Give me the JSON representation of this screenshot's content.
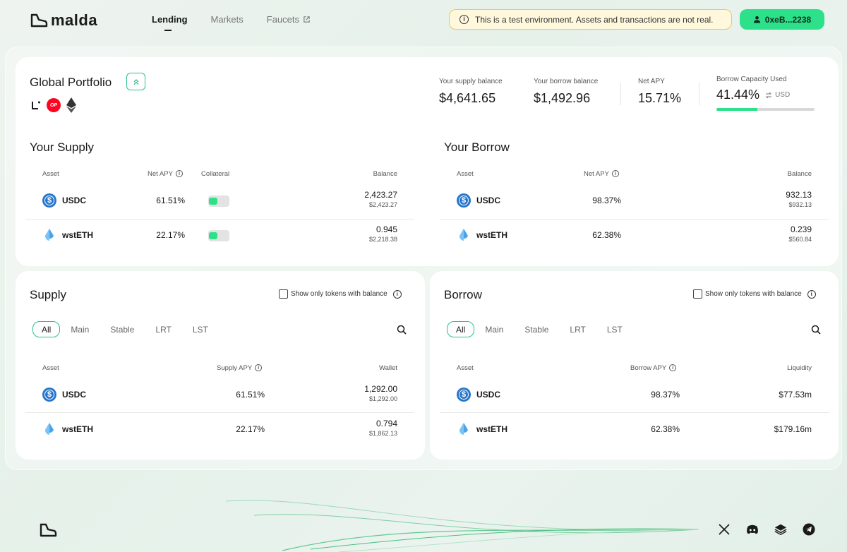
{
  "brand": {
    "name": "malda"
  },
  "nav": [
    {
      "label": "Lending",
      "active": true
    },
    {
      "label": "Markets",
      "active": false
    },
    {
      "label": "Faucets",
      "active": false,
      "external": true
    }
  ],
  "notice": {
    "text": "This is a test environment. Assets and transactions are not real."
  },
  "wallet": {
    "address": "0xeB...2238"
  },
  "portfolio": {
    "title": "Global Portfolio",
    "chains": [
      "linea-icon",
      "optimism-icon",
      "ethereum-icon"
    ],
    "op_label": "OP",
    "stats": {
      "supply_label": "Your supply balance",
      "supply_value": "$4,641.65",
      "borrow_label": "Your borrow balance",
      "borrow_value": "$1,492.96",
      "apy_label": "Net APY",
      "apy_value": "15.71%",
      "capacity_label": "Borrow Capacity Used",
      "capacity_value": "41.44%",
      "capacity_unit": "USD",
      "capacity_fraction": 0.4144
    }
  },
  "your_supply": {
    "title": "Your Supply",
    "headers": {
      "asset": "Asset",
      "apy": "Net APY",
      "collateral": "Collateral",
      "balance": "Balance"
    },
    "rows": [
      {
        "asset": "USDC",
        "apy": "61.51%",
        "collateral": true,
        "balance": "2,423.27",
        "balance_usd": "$2,423.27"
      },
      {
        "asset": "wstETH",
        "apy": "22.17%",
        "collateral": true,
        "balance": "0.945",
        "balance_usd": "$2,218.38"
      }
    ]
  },
  "your_borrow": {
    "title": "Your Borrow",
    "headers": {
      "asset": "Asset",
      "apy": "Net APY",
      "balance": "Balance"
    },
    "rows": [
      {
        "asset": "USDC",
        "apy": "98.37%",
        "balance": "932.13",
        "balance_usd": "$932.13"
      },
      {
        "asset": "wstETH",
        "apy": "62.38%",
        "balance": "0.239",
        "balance_usd": "$560.84"
      }
    ]
  },
  "supply_market": {
    "title": "Supply",
    "filter_label": "Show only tokens with balance",
    "tabs": [
      "All",
      "Main",
      "Stable",
      "LRT",
      "LST"
    ],
    "headers": {
      "asset": "Asset",
      "apy": "Supply APY",
      "wallet": "Wallet"
    },
    "rows": [
      {
        "asset": "USDC",
        "apy": "61.51%",
        "wallet": "1,292.00",
        "wallet_usd": "$1,292.00"
      },
      {
        "asset": "wstETH",
        "apy": "22.17%",
        "wallet": "0.794",
        "wallet_usd": "$1,862.13"
      }
    ]
  },
  "borrow_market": {
    "title": "Borrow",
    "filter_label": "Show only tokens with balance",
    "tabs": [
      "All",
      "Main",
      "Stable",
      "LRT",
      "LST"
    ],
    "headers": {
      "asset": "Asset",
      "apy": "Borrow APY",
      "liquidity": "Liquidity"
    },
    "rows": [
      {
        "asset": "USDC",
        "apy": "98.37%",
        "liquidity": "$77.53m"
      },
      {
        "asset": "wstETH",
        "apy": "62.38%",
        "liquidity": "$179.16m"
      }
    ]
  },
  "footer": {
    "socials": [
      "x-icon",
      "discord-icon",
      "gitbook-icon",
      "telegram-icon"
    ]
  },
  "colors": {
    "accent": "#2de08a",
    "accent_border": "#2dbf86",
    "notice_border": "#e7c86a",
    "usdc": "#2775ca"
  }
}
